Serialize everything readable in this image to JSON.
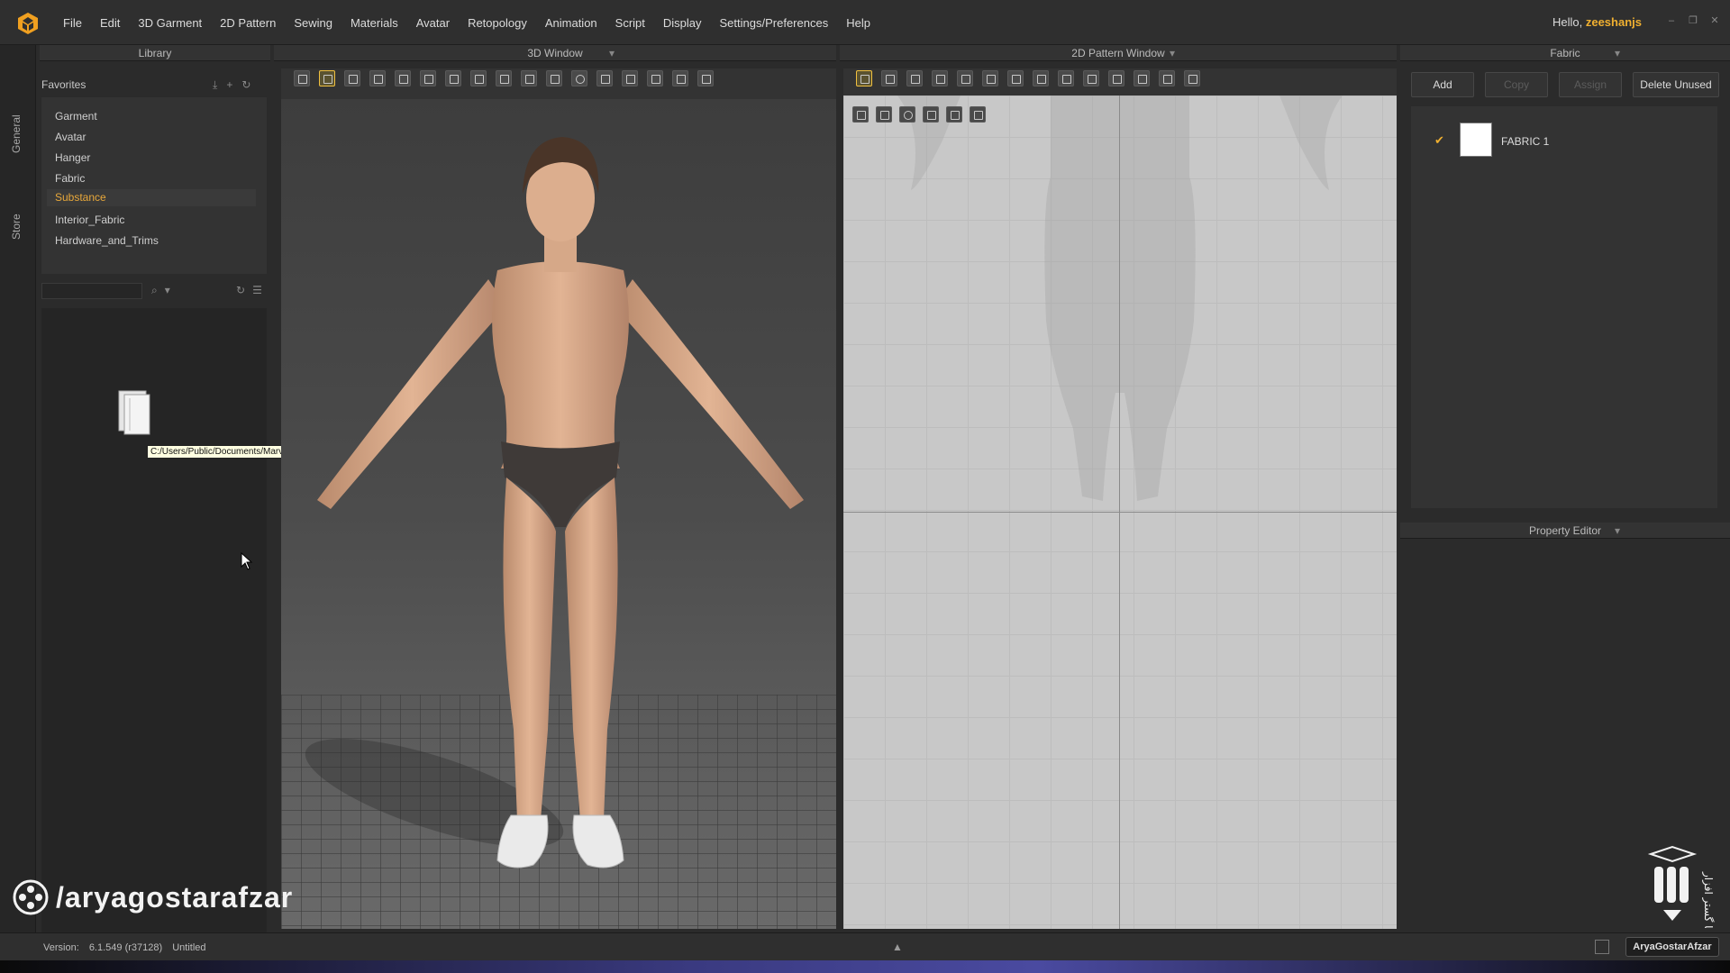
{
  "menubar": {
    "items": [
      "File",
      "Edit",
      "3D Garment",
      "2D Pattern",
      "Sewing",
      "Materials",
      "Avatar",
      "Retopology",
      "Animation",
      "Script",
      "Display",
      "Settings/Preferences",
      "Help"
    ],
    "greeting_prefix": "Hello,",
    "username": "zeeshanjs"
  },
  "side_tabs": {
    "general": "General",
    "store": "Store"
  },
  "library": {
    "title": "Library",
    "favorites_label": "Favorites",
    "items": [
      "Garment",
      "Avatar",
      "Hanger",
      "Fabric",
      "Substance",
      "Interior_Fabric",
      "Hardware_and_Trims"
    ],
    "selected": "Substance",
    "tooltip_path": "C:/Users/Public/Documents/MarvelousDesigner/Assets/Materials"
  },
  "window_3d": {
    "title": "3D Window"
  },
  "window_2d": {
    "title": "2D Pattern Window"
  },
  "fabric": {
    "title": "Fabric",
    "buttons": {
      "add": "Add",
      "copy": "Copy",
      "assign": "Assign",
      "delete_unused": "Delete Unused"
    },
    "list": [
      {
        "name": "FABRIC 1",
        "color": "#ffffff",
        "checked": true
      }
    ]
  },
  "property_editor": {
    "title": "Property Editor"
  },
  "statusbar": {
    "version_label": "Version:",
    "version": "6.1.549 (r37128)",
    "document": "Untitled",
    "badge": "AryaGostarAfzar"
  },
  "watermark": {
    "handle": "/aryagostarafzar"
  },
  "colors": {
    "accent": "#f0b030",
    "panel": "#2b2b2b",
    "viewport2d": "#c8c8c8"
  }
}
